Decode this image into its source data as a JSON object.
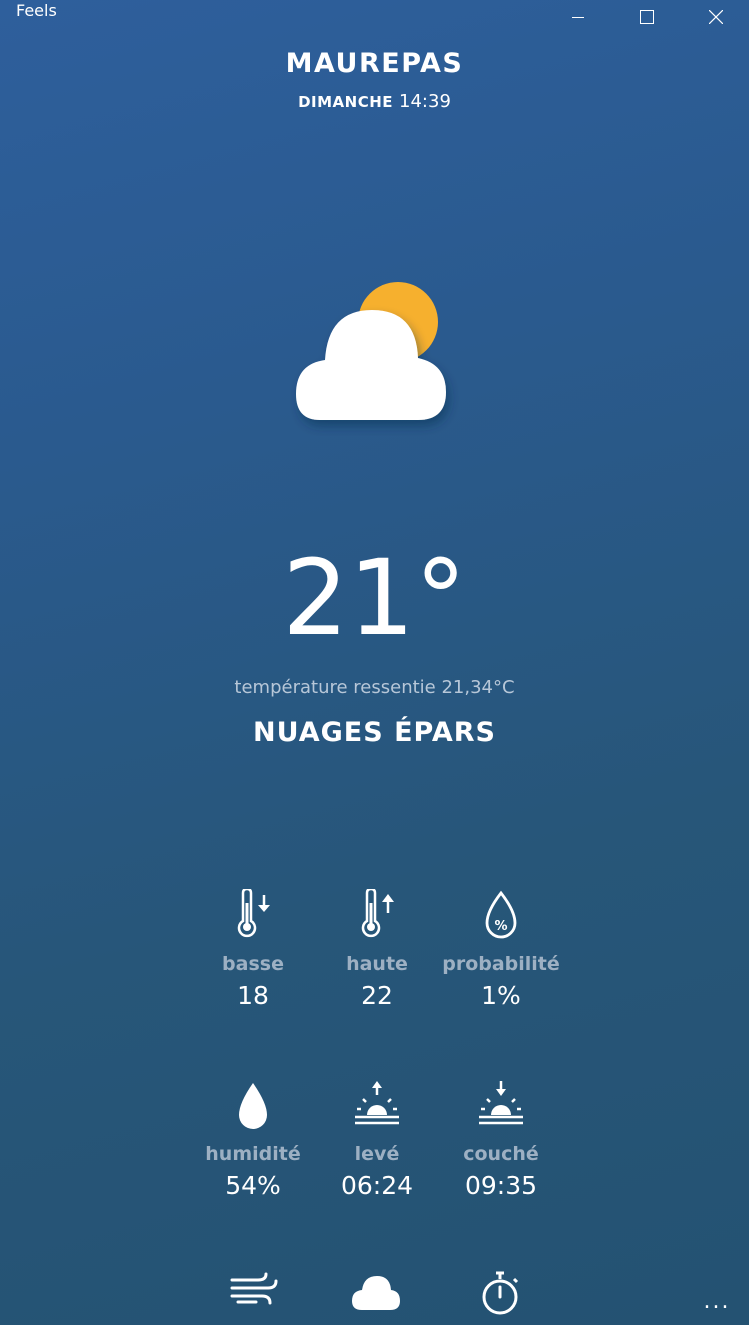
{
  "app": {
    "title": "Feels"
  },
  "location": {
    "city": "MAUREPAS",
    "day": "DIMANCHE",
    "time": "14:39"
  },
  "current": {
    "temperature": "21°",
    "feels_like": "température ressentie 21,34°C",
    "condition": "NUAGES ÉPARS",
    "icon": "partly-cloudy-icon"
  },
  "stats": [
    {
      "label": "basse",
      "value": "18",
      "icon": "thermometer-down-icon"
    },
    {
      "label": "haute",
      "value": "22",
      "icon": "thermometer-up-icon"
    },
    {
      "label": "probabilité",
      "value": "1%",
      "icon": "precipitation-chance-icon"
    },
    {
      "label": "humidité",
      "value": "54%",
      "icon": "humidity-drop-icon"
    },
    {
      "label": "levé",
      "value": "06:24",
      "icon": "sunrise-icon"
    },
    {
      "label": "couché",
      "value": "09:35",
      "icon": "sunset-icon"
    }
  ],
  "bottom_icons": [
    "wind-icon",
    "cloud-icon",
    "stopwatch-icon"
  ],
  "more_label": "...",
  "colors": {
    "sun": "#f6b02e",
    "label": "#9db0c3",
    "feels": "#b7c7d8"
  }
}
